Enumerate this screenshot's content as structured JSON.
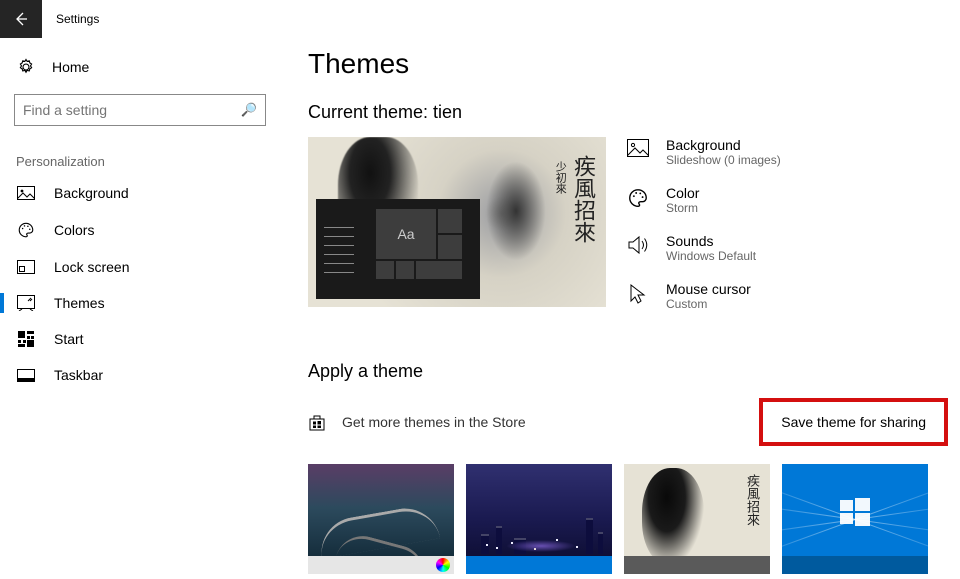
{
  "titlebar": {
    "label": "Settings"
  },
  "sidebar": {
    "home_label": "Home",
    "search_placeholder": "Find a setting",
    "section": "Personalization",
    "items": [
      {
        "label": "Background"
      },
      {
        "label": "Colors"
      },
      {
        "label": "Lock screen"
      },
      {
        "label": "Themes"
      },
      {
        "label": "Start"
      },
      {
        "label": "Taskbar"
      }
    ]
  },
  "main": {
    "title": "Themes",
    "current_theme_label": "Current theme: tien",
    "preview": {
      "calligraphy_main": "疾風招來",
      "calligraphy_small": "少初來",
      "tile_label": "Aa"
    },
    "settings": {
      "background": {
        "label": "Background",
        "value": "Slideshow (0 images)"
      },
      "color": {
        "label": "Color",
        "value": "Storm"
      },
      "sounds": {
        "label": "Sounds",
        "value": "Windows Default"
      },
      "cursor": {
        "label": "Mouse cursor",
        "value": "Custom"
      }
    },
    "apply_title": "Apply a theme",
    "store_link": "Get more themes in the Store",
    "save_button": "Save theme for sharing",
    "theme3_cal": "疾風招來"
  }
}
